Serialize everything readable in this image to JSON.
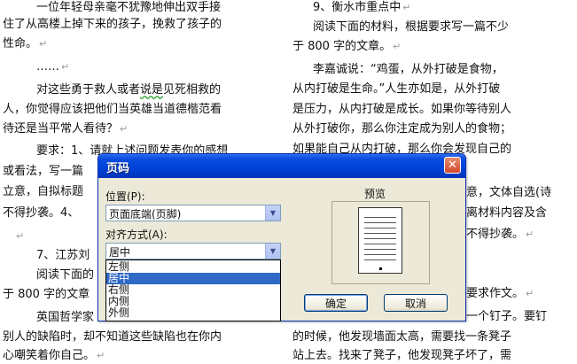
{
  "document": {
    "left_lines": [
      "　一位年轻母亲毫不犹豫地伸出双手接",
      "住了从高楼上掉下来的孩子，挽救了孩子的",
      "性命。",
      "　……",
      "　对这些勇于救人或者说是见死相救的",
      "人，你觉得应该把他们当英雄当道德楷范看",
      "待还是当平常人看待？",
      "　要求：1、请就上述问题发表你的感想",
      "或看法，写一篇",
      "立意，自拟标题",
      "不得抄袭。4、",
      "",
      "　7、江苏刘",
      "　阅读下面的",
      "于 800 字的文章",
      "　英国哲学家",
      "别人的缺陷时，却不知道这些缺陷也在你内",
      "心嘲笑着你自己。"
    ],
    "left_marks": [
      "",
      "",
      "↵",
      "",
      "",
      "",
      "↵",
      "",
      "",
      "",
      "",
      "↵",
      "",
      "",
      "",
      "",
      "",
      "↵"
    ],
    "right_lines": [
      "　9、衡水市重点中",
      "　阅读下面的材料，根据要求写一篇不少",
      "于 800 字的文章。",
      "　李嘉诚说：“鸡蛋，从外打破是食物，",
      "从内打破是生命。”人生亦如是，从外打破",
      "是压力，从内打破是成长。如果你等待别人",
      "从外打破你，那么你注定成为别人的食物；",
      "如果能自己从内打破，那么你会发现自己的",
      "",
      "",
      "",
      "",
      "",
      "",
      "",
      "",
      "的时候，他发现墙面太高，需要找一条凳子",
      "站上去。找来了凳子，他发现凳子坏了，需"
    ],
    "right_marks": [
      "↵",
      "",
      "↵",
      "",
      "",
      "",
      "",
      "",
      "",
      "",
      "",
      "",
      "",
      "",
      "",
      "",
      "",
      ""
    ],
    "right_fragments": [
      "意，文体自选(诗",
      "离材料内容及含",
      "不得抄袭。",
      "要求作文。",
      "一个钉子。要钉"
    ],
    "right_fragment_marks": [
      "",
      "",
      "↵",
      "↵",
      ""
    ],
    "wavy_phrase": "说是"
  },
  "dialog": {
    "title": "页码",
    "close_glyph": "✕",
    "position_label": "位置(P):",
    "position_value": "页面底端(页脚)",
    "alignment_label": "对齐方式(A):",
    "alignment_value": "居中",
    "alignment_options": [
      "左侧",
      "居中",
      "右侧",
      "内侧",
      "外侧"
    ],
    "alignment_selected_index": 1,
    "preview_label": "预览",
    "ok_label": "确定",
    "cancel_label": "取消",
    "combo_arrow_glyph": "▼"
  }
}
